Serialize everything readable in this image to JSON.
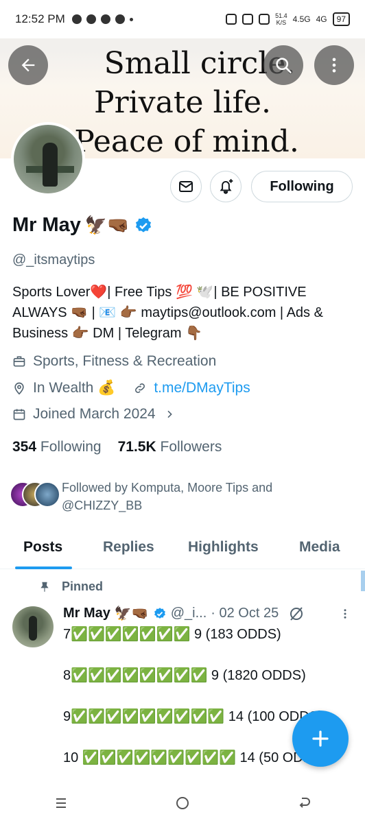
{
  "status_bar": {
    "time": "12:52 PM",
    "net_speed": "51.4",
    "net_unit": "K/S",
    "signal_1": "4.5G",
    "signal_2": "4G",
    "battery": "97"
  },
  "banner": {
    "line1": "Small circle.",
    "line2": "Private life.",
    "line3": "Peace of mind."
  },
  "profile": {
    "display_name": "Mr May",
    "name_emojis": "🦅🤜🏾",
    "handle": "@_itsmaytips",
    "bio": "Sports Lover❤️| Free Tips 💯 🕊️| BE POSITIVE ALWAYS 🤜🏾 | 📧 👉🏾 maytips@outlook.com | Ads & Business 👉🏾 DM | Telegram 👇🏾",
    "category": "Sports, Fitness & Recreation",
    "location": "In Wealth 💰",
    "link": "t.me/DMayTips",
    "joined": "Joined March 2024",
    "following_count": "354",
    "following_label": "Following",
    "followers_count": "71.5K",
    "followers_label": "Followers",
    "followed_by": "Followed by Komputa, Moore Tips and @CHIZZY_BB",
    "follow_button": "Following"
  },
  "tabs": [
    "Posts",
    "Replies",
    "Highlights",
    "Media"
  ],
  "post": {
    "pinned_label": "Pinned",
    "author": "Mr May",
    "author_emojis": "🦅🤜🏾",
    "handle": "@_i...",
    "date": "· 02 Oct 25",
    "body": "7✅✅✅✅✅✅✅ 9 (183 ODDS)\n\n8✅✅✅✅✅✅✅✅ 9 (1820 ODDS)\n\n9✅✅✅✅✅✅✅✅✅ 14 (100 ODDS)\n\n10 ✅✅✅✅✅✅✅✅✅ 14 (50 ODDS)"
  },
  "colors": {
    "accent": "#1d9bf0",
    "text_primary": "#0f1419",
    "text_secondary": "#536471",
    "border": "#cfd9de"
  },
  "icons": {
    "back": "arrow-left-icon",
    "search": "search-icon",
    "more": "more-vertical-icon",
    "message": "envelope-icon",
    "notify": "bell-plus-icon",
    "category": "briefcase-icon",
    "location": "map-pin-icon",
    "link": "link-icon",
    "joined": "calendar-icon",
    "pinned": "pin-icon",
    "verified": "verified-badge-icon",
    "grok": "grok-icon",
    "compose": "plus-icon"
  }
}
